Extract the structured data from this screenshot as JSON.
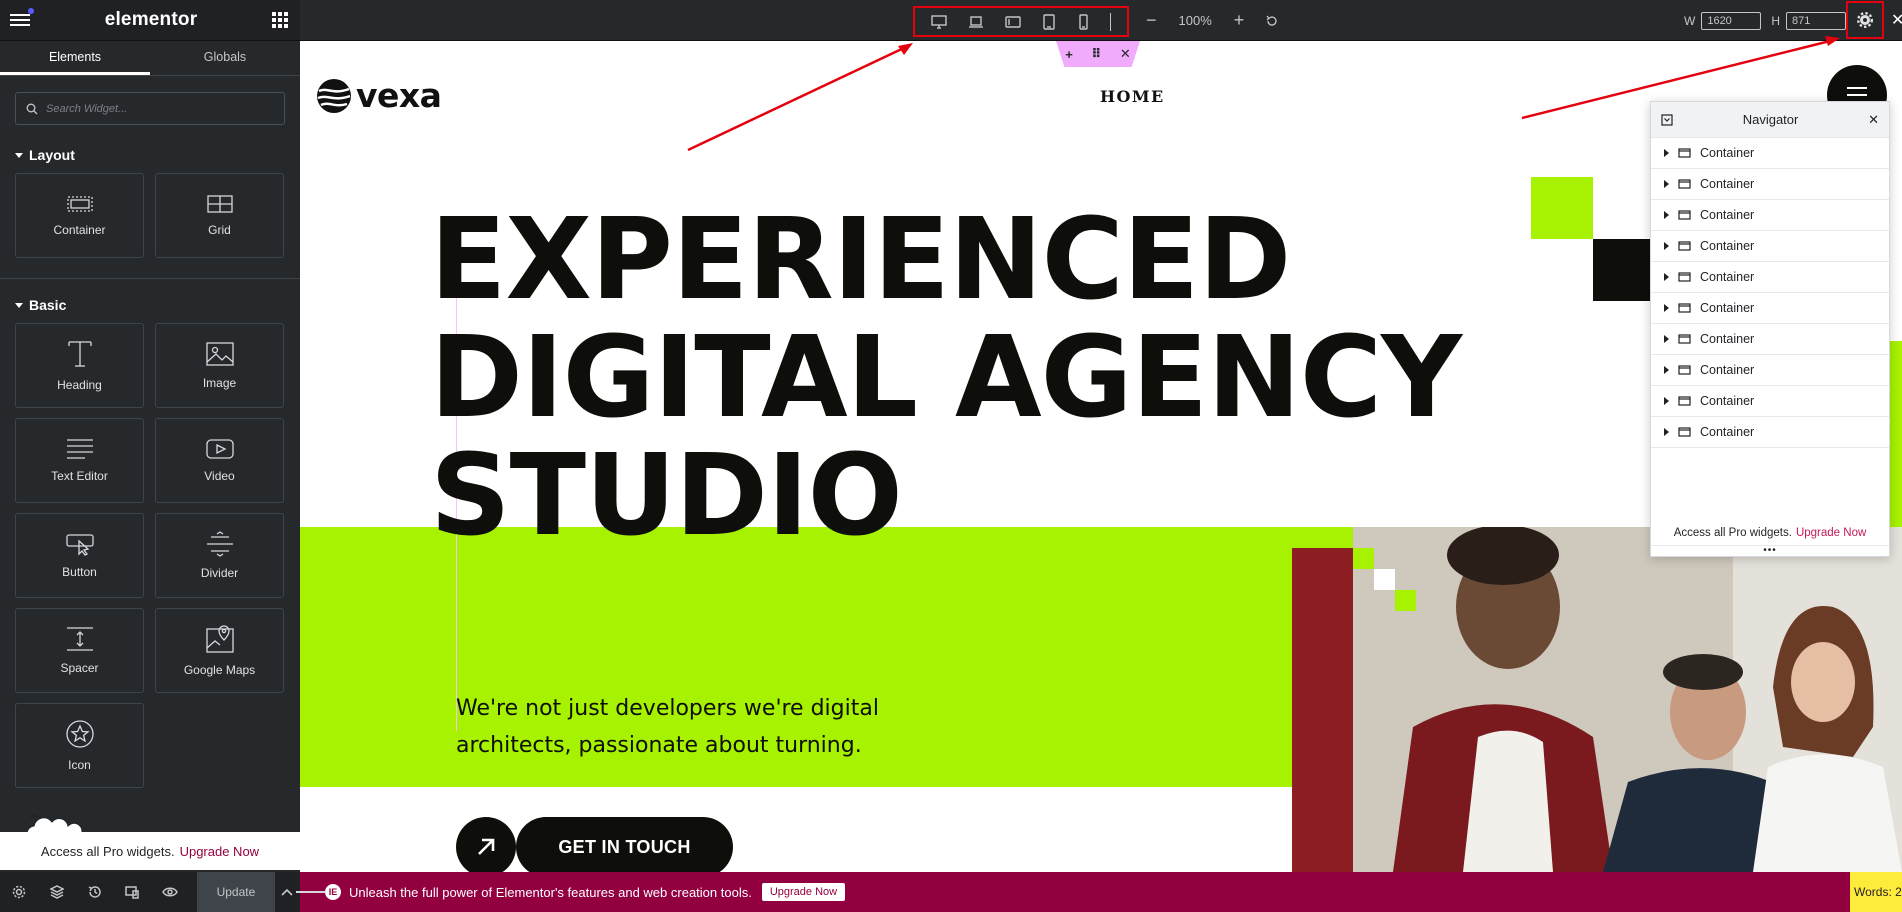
{
  "panel": {
    "logo": "elementor",
    "tabs": [
      {
        "label": "Elements"
      },
      {
        "label": "Globals"
      }
    ],
    "search_placeholder": "Search Widget...",
    "sections": [
      {
        "title": "Layout",
        "widgets": [
          {
            "label": "Container",
            "icon": "container-icon"
          },
          {
            "label": "Grid",
            "icon": "grid-icon"
          }
        ]
      },
      {
        "title": "Basic",
        "widgets": [
          {
            "label": "Heading",
            "icon": "heading-icon"
          },
          {
            "label": "Image",
            "icon": "image-icon"
          },
          {
            "label": "Text Editor",
            "icon": "text-editor-icon"
          },
          {
            "label": "Video",
            "icon": "video-icon"
          },
          {
            "label": "Button",
            "icon": "button-icon"
          },
          {
            "label": "Divider",
            "icon": "divider-icon"
          },
          {
            "label": "Spacer",
            "icon": "spacer-icon"
          },
          {
            "label": "Google Maps",
            "icon": "google-maps-icon"
          },
          {
            "label": "Icon",
            "icon": "star-icon"
          }
        ]
      }
    ],
    "pro_banner": {
      "text": "Access all Pro widgets.",
      "link": "Upgrade Now"
    },
    "footer": {
      "update_label": "Update"
    }
  },
  "topbar": {
    "zoom": "100%",
    "width_label": "W",
    "width_value": "1620",
    "height_label": "H",
    "height_value": "871"
  },
  "site": {
    "logo": "vexa",
    "nav_home": "HOME",
    "hero_lines": [
      "EXPERIENCED",
      "DIGITAL AGENCY",
      "STUDIO"
    ],
    "subtitle": "We're not just developers we're digital architects, passionate about turning.",
    "cta": "GET IN TOUCH"
  },
  "navigator": {
    "title": "Navigator",
    "items": [
      "Container",
      "Container",
      "Container",
      "Container",
      "Container",
      "Container",
      "Container",
      "Container",
      "Container",
      "Container"
    ],
    "footer_text": "Access all Pro widgets.",
    "footer_link": "Upgrade Now"
  },
  "notice": {
    "text": "Unleash the full power of Elementor's features and web creation tools.",
    "button": "Upgrade Now",
    "words": "Words: 2"
  },
  "colors": {
    "accent_green": "#a6f200",
    "pro_magenta": "#93003f",
    "highlight_red": "#e5000d",
    "panel_dark": "#26292c"
  }
}
